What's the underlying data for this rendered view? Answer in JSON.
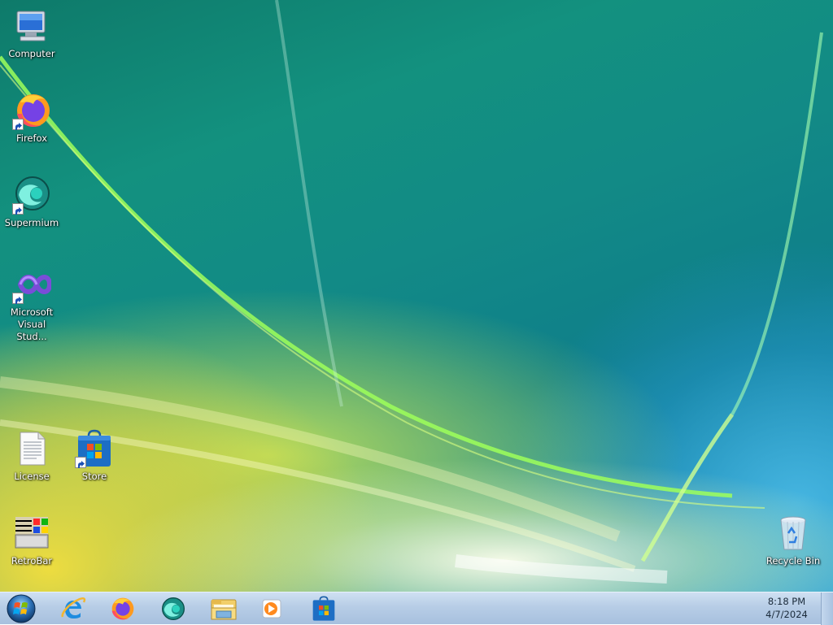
{
  "desktop": {
    "icons": [
      {
        "label": "Computer",
        "icon": "computer-icon"
      },
      {
        "label": "Firefox",
        "icon": "firefox-icon"
      },
      {
        "label": "Supermium",
        "icon": "supermium-icon"
      },
      {
        "label": "Microsoft Visual Stud...",
        "icon": "visual-studio-icon"
      },
      {
        "label": "License",
        "icon": "document-icon"
      },
      {
        "label": "Store",
        "icon": "store-icon"
      },
      {
        "label": "RetroBar",
        "icon": "retrobar-icon"
      },
      {
        "label": "Recycle Bin",
        "icon": "recycle-bin-icon"
      }
    ]
  },
  "taskbar": {
    "pinned": [
      {
        "icon": "start-orb-icon"
      },
      {
        "icon": "internet-explorer-icon"
      },
      {
        "icon": "firefox-icon"
      },
      {
        "icon": "supermium-icon"
      },
      {
        "icon": "file-explorer-icon"
      },
      {
        "icon": "media-player-icon"
      },
      {
        "icon": "store-icon"
      }
    ],
    "clock": {
      "time": "8:18 PM",
      "date": "4/7/2024"
    }
  },
  "colors": {
    "taskbar_top": "#cfe0f2",
    "taskbar_bottom": "#a7c0de",
    "desktop_teal": "#128a86"
  }
}
